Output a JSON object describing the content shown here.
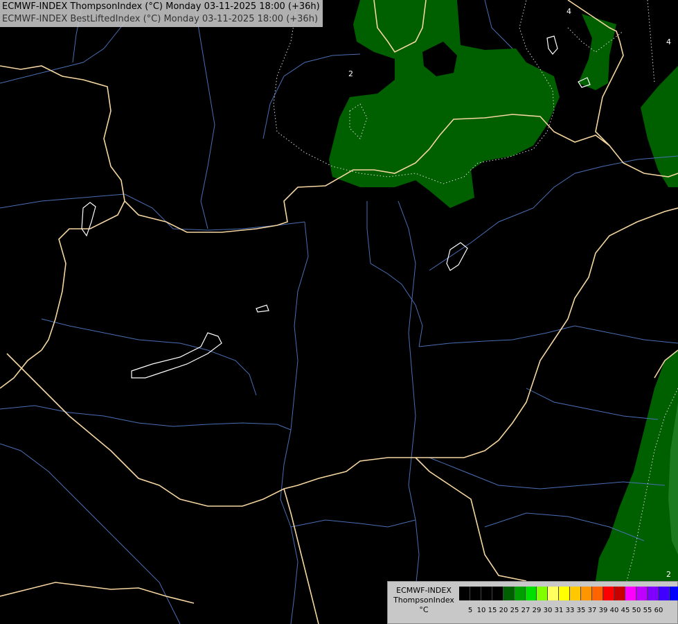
{
  "title": {
    "line1": "ECMWF-INDEX ThompsonIndex (°C) Monday 03-11-2025 18:00 (+36h)",
    "line2": "ECMWF-INDEX BestLiftedIndex (°C) Monday 03-11-2025 18:00 (+36h)"
  },
  "contour_labels": [
    "2",
    "4",
    "4",
    "2"
  ],
  "legend": {
    "line1": "ECMWF-INDEX",
    "line2": "ThompsonIndex",
    "line3": "°C",
    "ticks": [
      "5",
      "10",
      "15",
      "20",
      "25",
      "27",
      "29",
      "30",
      "31",
      "33",
      "35",
      "37",
      "39",
      "40",
      "45",
      "50",
      "55",
      "60"
    ],
    "colors": [
      "#000000",
      "#000000",
      "#000000",
      "#000000",
      "#006000",
      "#00a000",
      "#00e000",
      "#80ff00",
      "#ffff60",
      "#ffff00",
      "#ffc800",
      "#ff9600",
      "#ff6400",
      "#ff0000",
      "#c80000",
      "#ff00ff",
      "#c000ff",
      "#8000ff",
      "#4000ff",
      "#0000ff"
    ]
  },
  "colors": {
    "background": "#000000",
    "border": "#f5d6a0",
    "river": "#4a6fb5",
    "lake": "#ffffff",
    "index_fill": "#006000",
    "index_fill_light": "#1e7a1e"
  }
}
